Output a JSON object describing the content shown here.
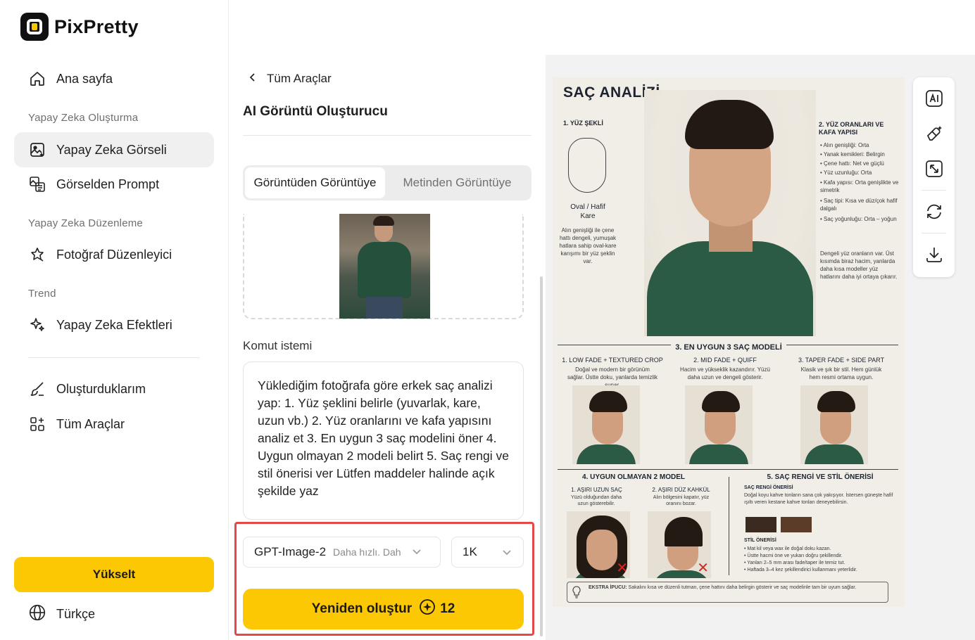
{
  "app": {
    "name": "PixPretty"
  },
  "sidebar": {
    "home": "Ana sayfa",
    "section_create": "Yapay Zeka Oluşturma",
    "item_ai_image": "Yapay Zeka Görseli",
    "item_image_prompt": "Görselden Prompt",
    "section_edit": "Yapay Zeka Düzenleme",
    "item_photo_editor": "Fotoğraf Düzenleyici",
    "section_trend": "Trend",
    "item_ai_effects": "Yapay Zeka Efektleri",
    "item_my_creations": "Oluşturduklarım",
    "item_all_tools": "Tüm Araçlar",
    "upgrade": "Yükselt",
    "language": "Türkçe"
  },
  "panel": {
    "back": "Tüm Araçlar",
    "title": "AI Görüntü Oluşturucu",
    "tab_img2img": "Görüntüden Görüntüye",
    "tab_txt2img": "Metinden Görüntüye",
    "prompt_label": "Komut istemi",
    "prompt_text": "Yüklediğim fotoğrafa göre erkek saç analizi yap: 1. Yüz şeklini belirle (yuvarlak, kare, uzun vb.) 2. Yüz oranlarını ve kafa yapısını analiz et 3. En uygun 3 saç modelini öner 4. Uygun olmayan 2 modeli belirt 5. Saç rengi ve stil önerisi ver Lütfen maddeler halinde açık şekilde yaz",
    "model": "GPT-Image-2",
    "model_sub": "Daha hızlı. Dah",
    "resolution": "1K",
    "regen": "Yeniden oluştur",
    "credits": "12"
  },
  "poster": {
    "title": "SAÇ ANALİZİ",
    "s1": "1. YÜZ ŞEKLİ",
    "s1_result": "Oval / Hafif Kare",
    "s1_desc": "Alın genişliği ile çene hattı dengeli, yumuşak hatlara sahip oval-kare karışımı bir yüz şeklin var.",
    "s2": "2. YÜZ ORANLARI VE KAFA YAPISI",
    "s2_items": [
      "• Alın genişliği: Orta",
      "• Yanak kemikleri: Belirgin",
      "• Çene hattı: Net ve güçlü",
      "• Yüz uzunluğu: Orta",
      "• Kafa yapısı: Orta genişlikte ve simetrik",
      "• Saç tipi: Kısa ve düz/çok hafif dalgalı",
      "• Saç yoğunluğu: Orta – yoğun"
    ],
    "s2_note": "Dengeli yüz oranların var. Üst kısımda biraz hacim, yanlarda daha kısa modeller yüz hatlarını daha iyi ortaya çıkarır.",
    "s3": "3. EN UYGUN 3 SAÇ MODELİ",
    "styles": [
      {
        "name": "1. LOW FADE + TEXTURED CROP",
        "desc": "Doğal ve modern bir görünüm sağlar. Üstte doku, yanlarda temizlik sunar."
      },
      {
        "name": "2. MID FADE + QUIFF",
        "desc": "Hacim ve yükseklik kazandırır. Yüzü daha uzun ve dengeli gösterir."
      },
      {
        "name": "3. TAPER FADE + SIDE PART",
        "desc": "Klasik ve şık bir stil. Hem günlük hem resmi ortama uygun."
      }
    ],
    "s4": "4. UYGUN OLMAYAN 2 MODEL",
    "bad": [
      {
        "name": "1. AŞIRI UZUN SAÇ",
        "desc": "Yüzü olduğundan daha uzun gösterebilir."
      },
      {
        "name": "2. AŞIRI DÜZ KAHKÜL",
        "desc": "Alın bölgesini kapatır, yüz oranını bozar."
      }
    ],
    "s5": "5. SAÇ RENGİ VE STİL ÖNERİSİ",
    "color_title": "SAÇ RENGİ ÖNERİSİ",
    "color_desc": "Doğal koyu kahve tonların sana çok yakışıyor. İstersen güneşte hafif ışıltı veren kestane kahve tonları deneyebilirsin.",
    "style_title": "STİL ÖNERİSİ",
    "style_items": [
      "• Mat kil veya wax ile doğal doku kazan.",
      "• Üstte hacmi öne ve yukarı doğru şekillendir.",
      "• Yanları 2–5 mm arası fade/taper ile temiz tut.",
      "• Haftada 3–4 kez şekillendirici kullanmanı yeterlidir."
    ],
    "tip_label": "EKSTRA İPUCU:",
    "tip_text": "Sakalını kısa ve düzenli tutman, çene hattını daha belirgin gösterir ve saç modelinle tam bir uyum sağlar.",
    "swatch_colors": [
      "#3b2a1f",
      "#5a3c28"
    ]
  },
  "colors": {
    "accent": "#fcc804",
    "highlight": "#e54848"
  }
}
